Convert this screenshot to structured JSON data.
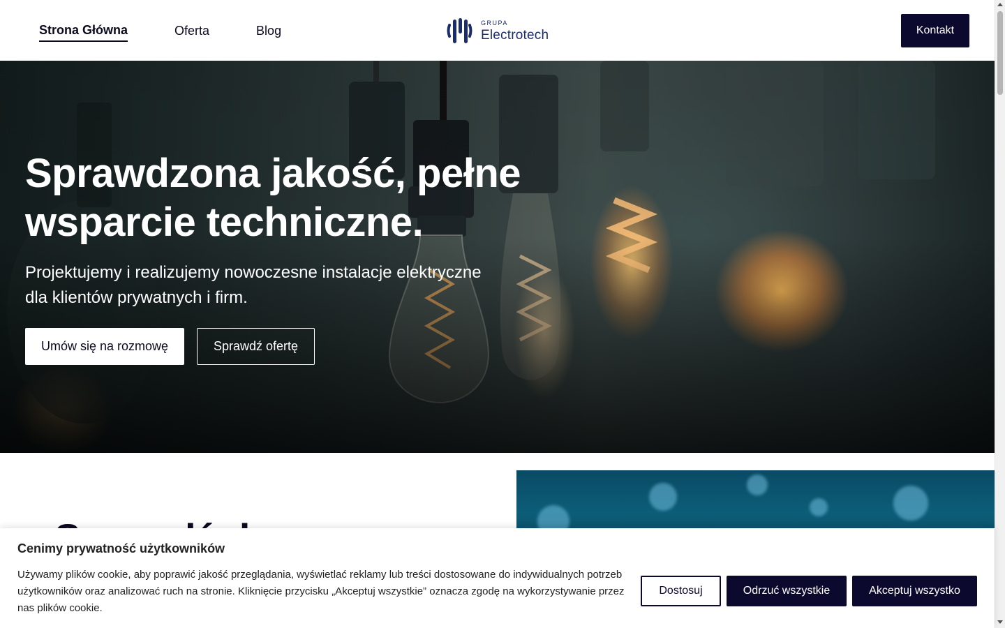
{
  "header": {
    "nav": [
      {
        "label": "Strona Główna",
        "active": true
      },
      {
        "label": "Oferta",
        "active": false
      },
      {
        "label": "Blog",
        "active": false
      }
    ],
    "logo": {
      "small": "GRUPA",
      "big": "Electrotech"
    },
    "contact_label": "Kontakt"
  },
  "hero": {
    "title_line1": "Sprawdzona jakość, pełne",
    "title_line2": "wsparcie techniczne.",
    "subtitle_line1": "Projektujemy i realizujemy nowoczesne instalacje elektryczne",
    "subtitle_line2": "dla klientów prywatnych i firm.",
    "primary_button": "Umów się na rozmowę",
    "secondary_button": "Sprawdź ofertę"
  },
  "section": {
    "title_partial": "+ Sprawdź do"
  },
  "cookie": {
    "title": "Cenimy prywatność użytkowników",
    "text": "Używamy plików cookie, aby poprawić jakość przeglądania, wyświetlać reklamy lub treści dostosowane do indywidualnych potrzeb użytkowników oraz analizować ruch na stronie. Kliknięcie przycisku „Akceptuj wszystkie” oznacza zgodę na wykorzystywanie przez nas plików cookie.",
    "customize": "Dostosuj",
    "reject": "Odrzuć wszystkie",
    "accept": "Akceptuj wszystko"
  },
  "colors": {
    "brand_navy": "#0b0a2e",
    "logo_blue": "#1c2b6b",
    "text": "#0b0a1f"
  }
}
